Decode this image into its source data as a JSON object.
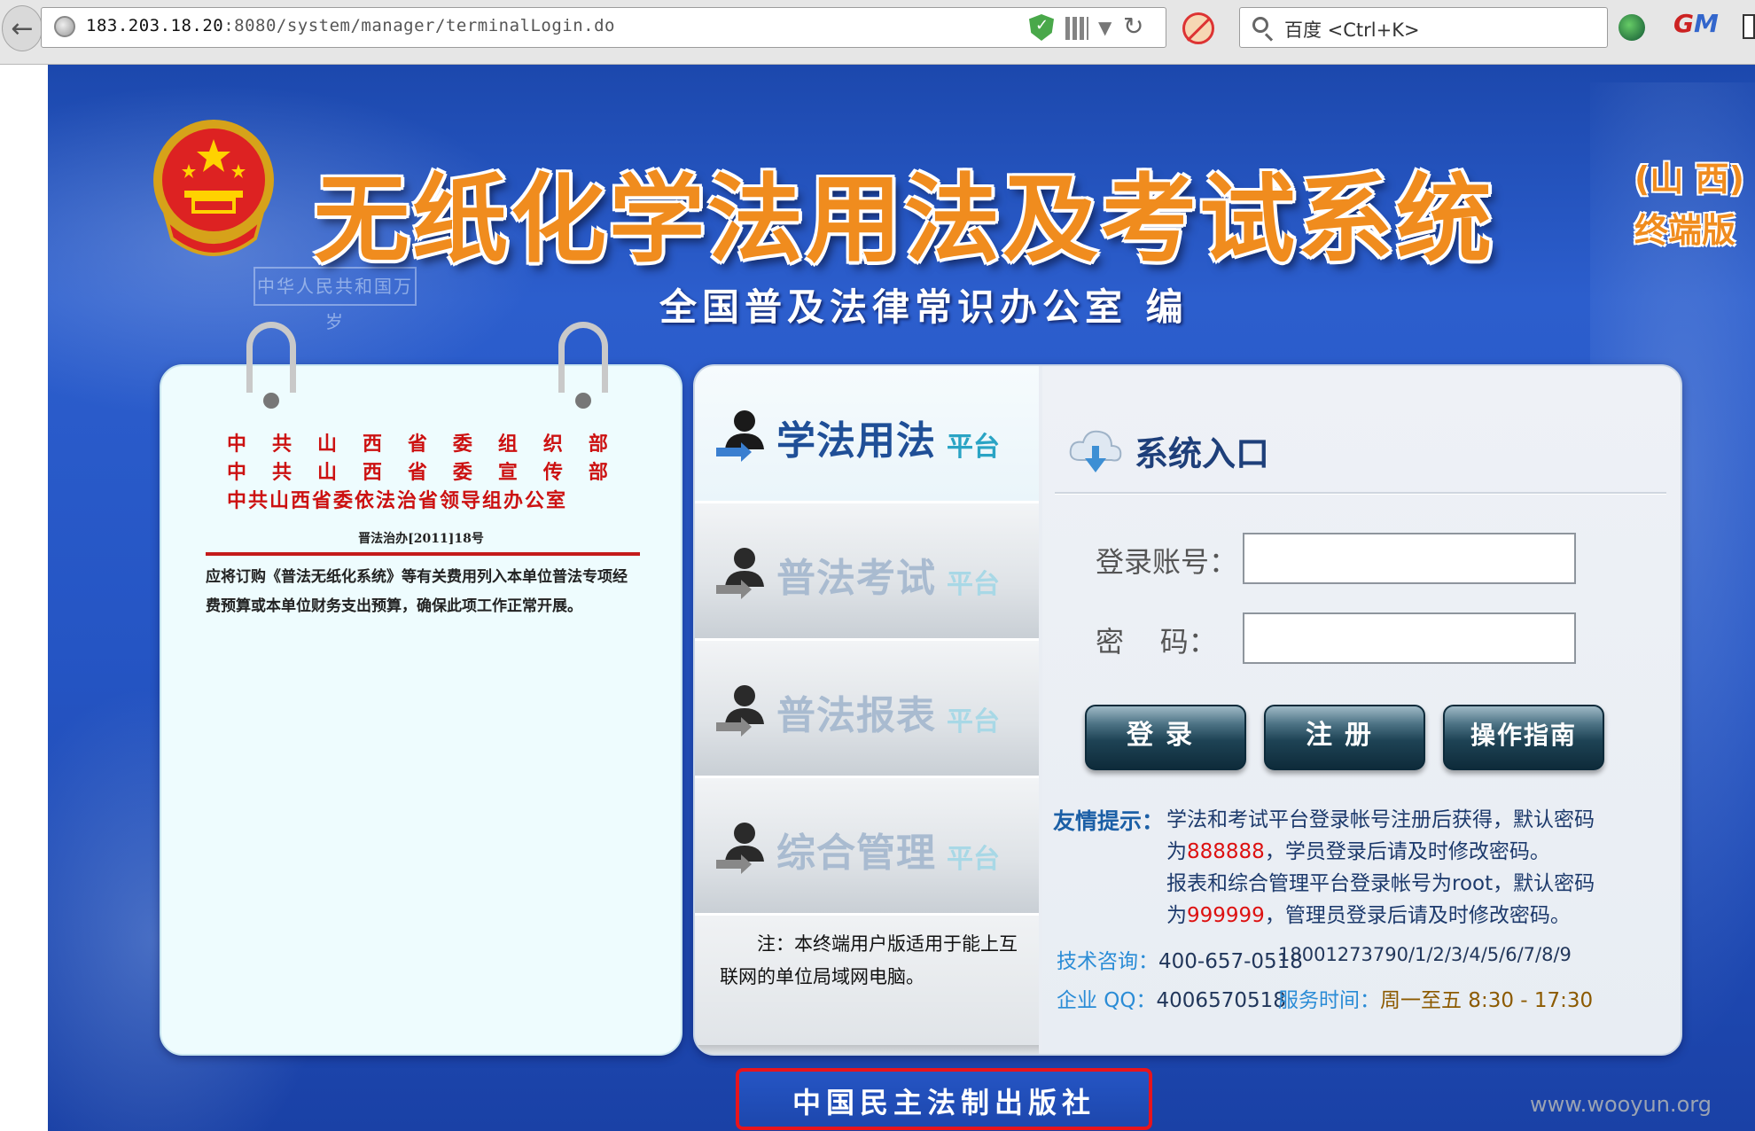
{
  "browser": {
    "url_host": "183.203.18.20",
    "url_rest": ":8080/system/manager/terminalLogin.do",
    "search_placeholder": "百度 <Ctrl+K>"
  },
  "header": {
    "main_title": "无纸化学法用法及考试系统",
    "side_line1": "(山 西)",
    "side_line2": "终端版",
    "subtitle": "全国普及法律常识办公室  编",
    "plaque": "中华人民共和国万岁"
  },
  "notice": {
    "issuer1_chars": [
      "中",
      "共",
      "山",
      "西",
      "省",
      "委",
      "组",
      "织",
      "部"
    ],
    "issuer2_chars": [
      "中",
      "共",
      "山",
      "西",
      "省",
      "委",
      "宣",
      "传",
      "部"
    ],
    "issuer3": "中共山西省委依法治省领导组办公室",
    "doc_no": "晋法治办[2011]18号",
    "body": "应将订购《普法无纸化系统》等有关费用列入本单位普法专项经费预算或本单位财务支出预算，确保此项工作正常开展。"
  },
  "tabs": [
    {
      "label": "学法用法",
      "sub": "平台"
    },
    {
      "label": "普法考试",
      "sub": "平台"
    },
    {
      "label": "普法报表",
      "sub": "平台"
    },
    {
      "label": "综合管理",
      "sub": "平台"
    }
  ],
  "tab_note": "注：本终端用户版适用于能上互联网的单位局域网电脑。",
  "login": {
    "entry_title": "系统入口",
    "account_label": "登录账号：",
    "password_label": "密    码：",
    "account_value": "",
    "password_value": "",
    "login_button": "登录",
    "register_button": "注册",
    "guide_button": "操作指南"
  },
  "tips": {
    "head": "友情提示：",
    "line1": "学法和考试平台登录帐号注册后获得，默认密码",
    "line2_pre": "为",
    "line2_red": "888888",
    "line2_post": "，学员登录后请及时修改密码。",
    "line3": "报表和综合管理平台登录帐号为root，默认密码",
    "line4_pre": "为",
    "line4_red": "999999",
    "line4_post": "，管理员登录后请及时修改密码。"
  },
  "contact": {
    "tech_label": "技术咨询：",
    "tech_phone": "400-657-0518",
    "mobile": "18001273790/1/2/3/4/5/6/7/8/9",
    "qq_label": "企业 QQ：",
    "qq_value": "4006570518",
    "hours_label": "服务时间：",
    "hours_value": "周一至五 8:30 - 17:30"
  },
  "footer": {
    "publisher": "中国民主法制出版社",
    "watermark": "www.wooyun.org"
  },
  "colors": {
    "title_orange": "#f08c1e",
    "page_blue": "#2555c4",
    "highlight_red": "#e8141c"
  }
}
